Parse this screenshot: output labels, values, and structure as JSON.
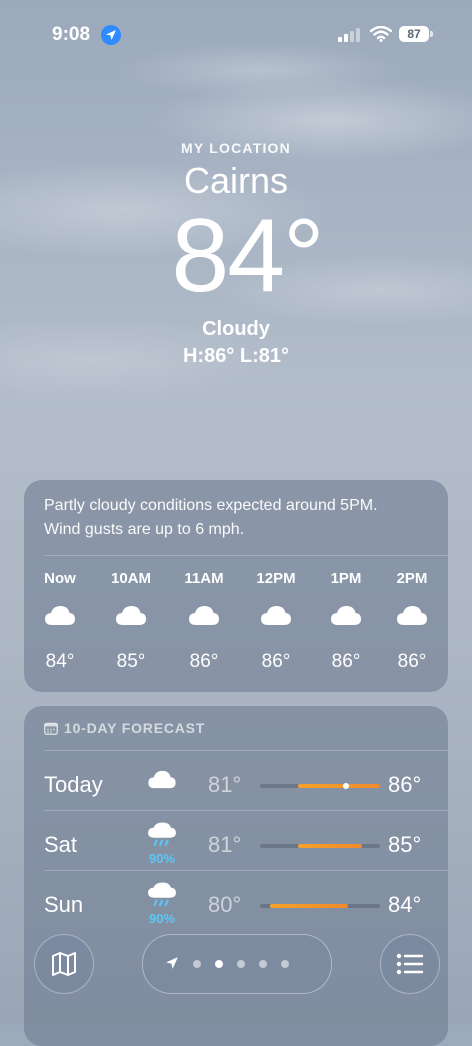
{
  "status_bar": {
    "time": "9:08",
    "battery": "87"
  },
  "header": {
    "my_location": "MY LOCATION",
    "city": "Cairns",
    "temperature": "84°",
    "condition": "Cloudy",
    "hilo": "H:86°  L:81°"
  },
  "hourly": {
    "summary_line1": "Partly cloudy conditions expected around 5PM.",
    "summary_line2": "Wind gusts are up to 6 mph.",
    "hours": [
      {
        "label": "Now",
        "temp": "84°",
        "icon": "cloud-icon"
      },
      {
        "label": "10AM",
        "temp": "85°",
        "icon": "cloud-icon"
      },
      {
        "label": "11AM",
        "temp": "86°",
        "icon": "cloud-icon"
      },
      {
        "label": "12PM",
        "temp": "86°",
        "icon": "cloud-icon"
      },
      {
        "label": "1PM",
        "temp": "86°",
        "icon": "cloud-icon"
      },
      {
        "label": "2PM",
        "temp": "86°",
        "icon": "cloud-icon"
      }
    ]
  },
  "forecast": {
    "title": "10-DAY FORECAST",
    "days": [
      {
        "day": "Today",
        "low": "81°",
        "high": "86°",
        "icon": "cloud-icon",
        "precip": "",
        "current_temp": 84
      },
      {
        "day": "Sat",
        "low": "81°",
        "high": "85°",
        "icon": "cloud-rain-icon",
        "precip": "90%"
      },
      {
        "day": "Sun",
        "low": "80°",
        "high": "84°",
        "icon": "cloud-rain-icon",
        "precip": "90%"
      }
    ]
  },
  "colors": {
    "accent_precip": "#5ac8fa",
    "temp_bar": "#f39a2a",
    "location_badge": "#2f8bff"
  },
  "toolbar": {
    "map_icon": "map-icon",
    "list_icon": "list-icon",
    "page_count": 5,
    "active_page": 1
  }
}
